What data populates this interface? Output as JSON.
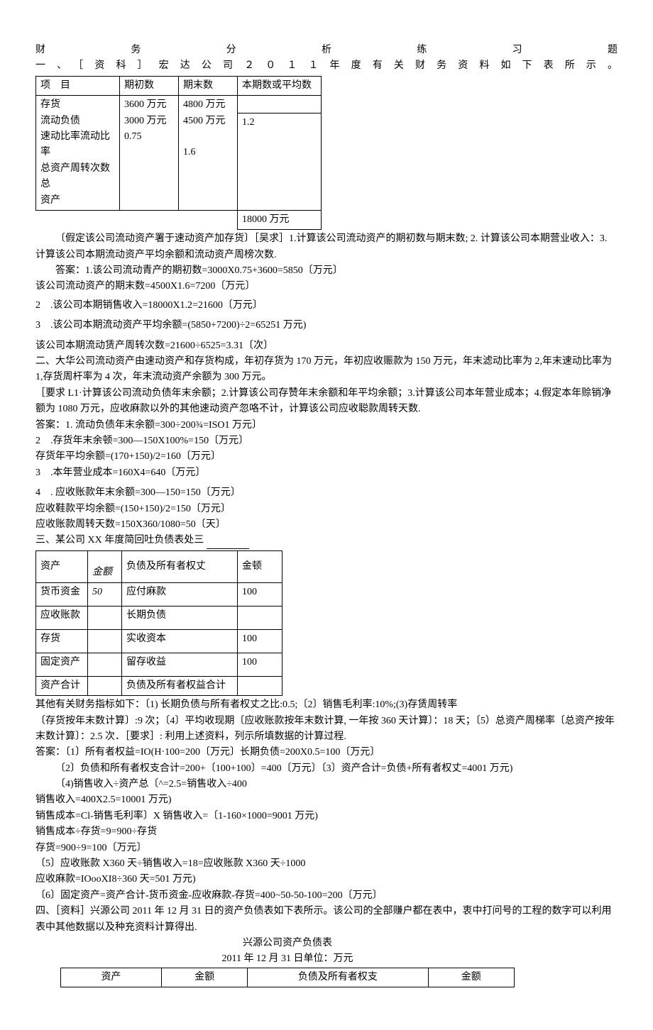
{
  "title_line1": "财务分析练习题",
  "title_line2": "一、［资科］宏达公司２０１１年度有关财务资料如下表所示。",
  "table1": {
    "h1": "项　目",
    "h2": "期初数",
    "h3": "期末数",
    "h4": "本期数或平均数",
    "r1c1": "存货",
    "r1c2": "3600 万元",
    "r1c3": "4800 万元",
    "r2c1": "流动负债",
    "r2c2": "3000 万元",
    "r2c3": "4500 万元",
    "r3c1": "速动比率流动比率",
    "r3c2": "0.75",
    "r4c1": "总资产周转次数总",
    "r4c3": "1.6",
    "r5c1": "资产",
    "r5c4": "1.2",
    "r6c4": "18000 万元"
  },
  "p1": "〔假定该公司流动资产署于速动资产加存货〕［吴求］1.计算该公司流动资产的期初数与期末数; 2. 计算该公司本期营业收入：3. 计算该公司本期流动资产平均余额和流动资产周榜次数.",
  "p2": "答案：1.该公司流动青产的期初数=3000X0.75+3600=5850〔万元〕",
  "p3": "该公司流动资产的期末数=4500X1.6=7200〔万元〕",
  "p4": "2　.该公司本期销售收入=18000X1.2=21600〔万元〕",
  "p5": "3　.该公司本期流动资产平均余额=(5850+7200)÷2=65251 万元)",
  "p6": "该公司本期流动赁产周转次数=21600÷6525=3.31〔次〕",
  "p7": "二、大华公司流动资产由速动资产和存货构成，年初存货为 170 万元，年初应收赈款为 150 万元，年末滤动比率为 2,年末速动比率为 1,存货周杆率为 4 次，年末流动资产余额为 300 万元。",
  "p8": "［要求 L1·计算该公司流动负债年末余额；2.计算该公司存赞年末余额和年平均余额；3.计算该公司本年营业成本；4.假定本年赊销净额为 1080 万元，应收麻款以外的其他速动资产忽咯不计，计算该公司应收聪款周转天数.",
  "p9": "答案：1. 流动负债年末余额=300÷200¾=ISO1 万元〕",
  "p10": "2　.存货年末余顿=300—150X100%=150〔万元〕",
  "p11": "存货年平均余额=(170+150)/2=160〔万元〕",
  "p12": "3　.本年营业成本=160X4=640〔万元〕",
  "p13": "4　. 应收账款年末余额=300—150=150〔万元〕",
  "p14": "应收鞋款平均余额=(150+150)/2=150〔万元〕",
  "p15": "应收账款周转天数=150X360/1080=50〔天〕",
  "p16a": "三、某公司 XX 年度简回吐负债表处三 ",
  "table2": {
    "h1": "资产",
    "h2": "金额",
    "h3": "负债及所有者权丈",
    "h4": "金顿",
    "r1c1": "货币资金",
    "r1c2": "50",
    "r1c3": "应付麻款",
    "r1c4": "100",
    "r2c1": "应收账款",
    "r2c3": "长期负债",
    "r3c1": "存货",
    "r3c3": "实收资本",
    "r3c4": "100",
    "r4c1": "固定资产",
    "r4c3": "留存收益",
    "r4c4": "100",
    "r5c1": "资产合计",
    "r5c3": "负债及所有者权益合计"
  },
  "p17": "其他有关财务指标如下：〔1) 长期负债与所有者权丈之比:0.5;〔2〕销售毛利率:10%;(3)存赁周转率",
  "p18": "〔存货按年末数计算〕:9 次；〔4〕平均收现期〔应收账款按年末数计算, 一年按 360 天计算〕：18 天；〔5）总资产周梯率〔总资产按年末数计算〕：2.5 次．［要求］: 利用上述资料，列示所填数据的计算过程.",
  "p19": "答案：〔1〕所有者权益=IO(H·100=200〔万元〕长期负债=200X0.5=100〔万元〕",
  "p20": "〔2〕负债和所有者权支合计=200+〔100+100〕=400〔万元〕〔3〕资产合计=负债+所有者权丈=4001 万元)",
  "p21": "〔4)销售收入÷资产总〔^=2.5=销售收入÷400",
  "p22": "销售收入=400X2.5=10001 万元)",
  "p23": "销售成本=Cl-销售毛利率〕X 销售收入=〔1-160×1000=9001 万元)",
  "p24": "销售成本÷存货=9=900÷存货",
  "p25": "存货=900÷9=100〔万元〕",
  "p26": "〔5〕应收账款 X360 天÷销售收入=18=应收账款 X360 天÷1000",
  "p27": "应收麻款=IOooXI8÷360 天=501 万元)",
  "p28": "〔6〕固定资产=资产合计-货币资金-应收麻款-存货=400~50-50-100=200〔万元〕",
  "p29": "四、［资料］兴源公司 2011 年 12 月 31 日的资产负债表如下表所示。该公司的全部赚户都在表中，衷中打问号的工程的数字可以利用表中其他数据以及种充资料计算得出.",
  "p30": "兴源公司资产负债表",
  "p31": "2011 年 12 月 31 日单位：万元",
  "table3": {
    "h1": "资产",
    "h2": "金额",
    "h3": "负债及所有者权支",
    "h4": "金额"
  }
}
